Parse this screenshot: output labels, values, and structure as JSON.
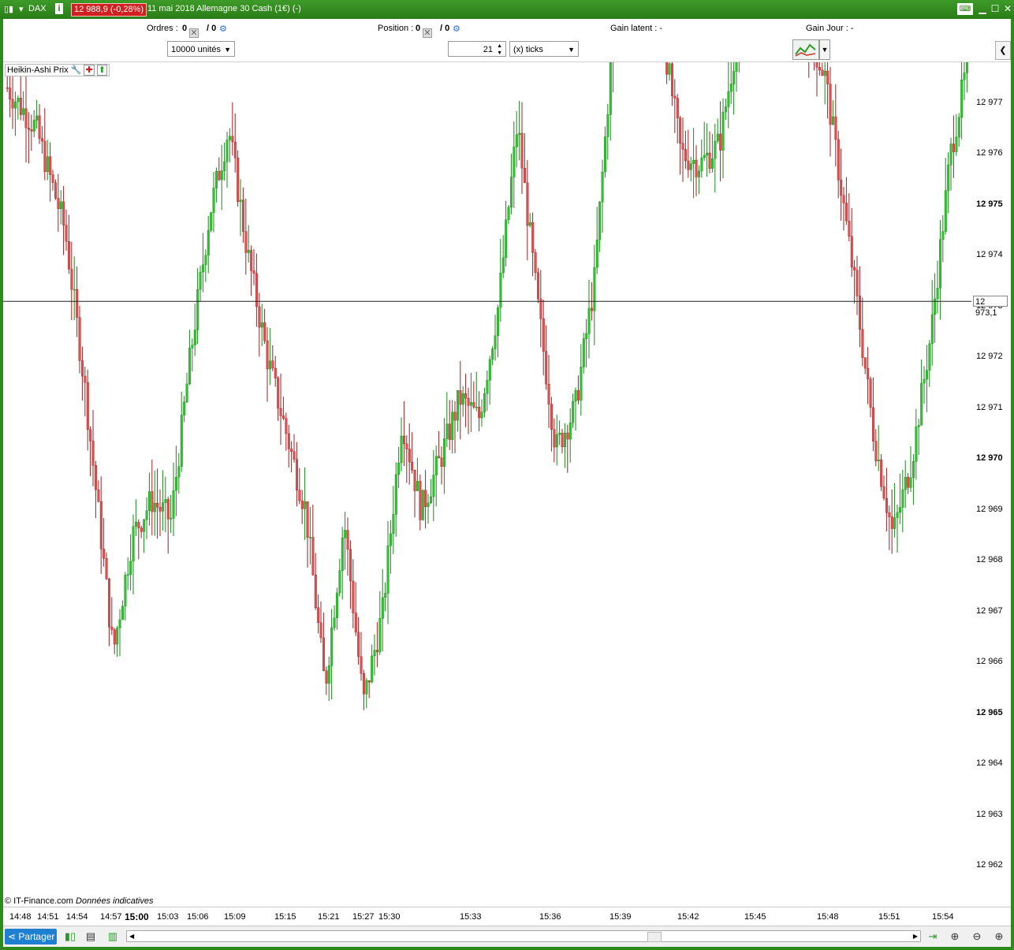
{
  "titlebar": {
    "symbol": "DAX",
    "info_icon": "i",
    "price_badge": "12 988,9 (-0,28%)",
    "title": "11 mai 2018 Allemagne 30 Cash (1€) (-)"
  },
  "infobar": {
    "orders_label": "Ordres :",
    "orders_value": "0",
    "orders_sep": "/ 0",
    "position_label": "Position :",
    "position_value": "0",
    "position_sep": "/ 0",
    "gain_latent": "Gain latent :  -",
    "gain_jour": "Gain Jour :  -"
  },
  "controls": {
    "units": "10000 unités",
    "tick_count": "21",
    "tick_mode": "(x) ticks"
  },
  "chart": {
    "indicator_label": "Heikin-Ashi Prix",
    "copyright": "© IT-Finance.com",
    "disclaimer": "Données indicatives",
    "current_price_label": "12 973,1",
    "bull_color": "#2fc42f",
    "bear_color": "#e05050"
  },
  "chart_data": {
    "type": "candlestick",
    "style": "Heikin-Ashi",
    "current_price": 12973.1,
    "ylim": [
      12961.2,
      12977.8
    ],
    "y_ticks": [
      {
        "label": "12 962",
        "value": 12962,
        "bold": false
      },
      {
        "label": "12 963",
        "value": 12963,
        "bold": false
      },
      {
        "label": "12 964",
        "value": 12964,
        "bold": false
      },
      {
        "label": "12 965",
        "value": 12965,
        "bold": true
      },
      {
        "label": "12 966",
        "value": 12966,
        "bold": false
      },
      {
        "label": "12 967",
        "value": 12967,
        "bold": false
      },
      {
        "label": "12 968",
        "value": 12968,
        "bold": false
      },
      {
        "label": "12 969",
        "value": 12969,
        "bold": false
      },
      {
        "label": "12 970",
        "value": 12970,
        "bold": true
      },
      {
        "label": "12 971",
        "value": 12971,
        "bold": false
      },
      {
        "label": "12 972",
        "value": 12972,
        "bold": false
      },
      {
        "label": "12 973",
        "value": 12973,
        "bold": false
      },
      {
        "label": "12 974",
        "value": 12974,
        "bold": false
      },
      {
        "label": "12 975",
        "value": 12975,
        "bold": true
      },
      {
        "label": "12 976",
        "value": 12976,
        "bold": false
      },
      {
        "label": "12 977",
        "value": 12977,
        "bold": false
      }
    ],
    "x_ticks": [
      {
        "label": "14:48",
        "bold": false
      },
      {
        "label": "14:51",
        "bold": false
      },
      {
        "label": "14:54",
        "bold": false
      },
      {
        "label": "14:57",
        "bold": false
      },
      {
        "label": "15:00",
        "bold": true
      },
      {
        "label": "15:03",
        "bold": false
      },
      {
        "label": "15:06",
        "bold": false
      },
      {
        "label": "15:09",
        "bold": false
      },
      {
        "label": "15:15",
        "bold": false
      },
      {
        "label": "15:21",
        "bold": false
      },
      {
        "label": "15:27",
        "bold": false
      },
      {
        "label": "15:30",
        "bold": false
      },
      {
        "label": "15:33",
        "bold": false
      },
      {
        "label": "15:36",
        "bold": false
      },
      {
        "label": "15:39",
        "bold": false
      },
      {
        "label": "15:42",
        "bold": false
      },
      {
        "label": "15:45",
        "bold": false
      },
      {
        "label": "15:48",
        "bold": false
      },
      {
        "label": "15:51",
        "bold": false
      },
      {
        "label": "15:54",
        "bold": false
      }
    ],
    "price_path": [
      {
        "t": 0,
        "v": 12977.3
      },
      {
        "t": 3,
        "v": 12976.5
      },
      {
        "t": 6,
        "v": 12974.5
      },
      {
        "t": 8,
        "v": 12971.5
      },
      {
        "t": 10,
        "v": 12968.0
      },
      {
        "t": 11,
        "v": 12966.2
      },
      {
        "t": 13,
        "v": 12968.5
      },
      {
        "t": 15,
        "v": 12969.2
      },
      {
        "t": 17,
        "v": 12968.8
      },
      {
        "t": 19,
        "v": 12972.0
      },
      {
        "t": 21,
        "v": 12974.8
      },
      {
        "t": 23,
        "v": 12976.5
      },
      {
        "t": 25,
        "v": 12974.0
      },
      {
        "t": 27,
        "v": 12972.0
      },
      {
        "t": 29,
        "v": 12970.5
      },
      {
        "t": 31,
        "v": 12969.0
      },
      {
        "t": 33,
        "v": 12965.5
      },
      {
        "t": 35,
        "v": 12968.8
      },
      {
        "t": 37,
        "v": 12965.2
      },
      {
        "t": 39,
        "v": 12967.0
      },
      {
        "t": 41,
        "v": 12970.8
      },
      {
        "t": 43,
        "v": 12969.0
      },
      {
        "t": 45,
        "v": 12970.0
      },
      {
        "t": 47,
        "v": 12971.2
      },
      {
        "t": 49,
        "v": 12970.8
      },
      {
        "t": 51,
        "v": 12973.0
      },
      {
        "t": 53,
        "v": 12976.6
      },
      {
        "t": 55,
        "v": 12973.2
      },
      {
        "t": 57,
        "v": 12970.2
      },
      {
        "t": 59,
        "v": 12971.0
      },
      {
        "t": 61,
        "v": 12973.5
      },
      {
        "t": 63,
        "v": 12978.5
      },
      {
        "t": 64,
        "v": 12979.5
      },
      {
        "t": 68,
        "v": 12978.5
      },
      {
        "t": 70,
        "v": 12976.0
      },
      {
        "t": 72,
        "v": 12975.8
      },
      {
        "t": 74,
        "v": 12976.2
      },
      {
        "t": 76,
        "v": 12978.5
      },
      {
        "t": 77,
        "v": 12979.5
      },
      {
        "t": 83,
        "v": 12978.5
      },
      {
        "t": 85,
        "v": 12977.5
      },
      {
        "t": 88,
        "v": 12973.5
      },
      {
        "t": 90,
        "v": 12970.5
      },
      {
        "t": 92,
        "v": 12968.5
      },
      {
        "t": 94,
        "v": 12970.0
      },
      {
        "t": 96,
        "v": 12972.5
      },
      {
        "t": 98,
        "v": 12976.0
      },
      {
        "t": 100,
        "v": 12978.0
      }
    ]
  },
  "bottombar": {
    "share_label": "Partager"
  }
}
